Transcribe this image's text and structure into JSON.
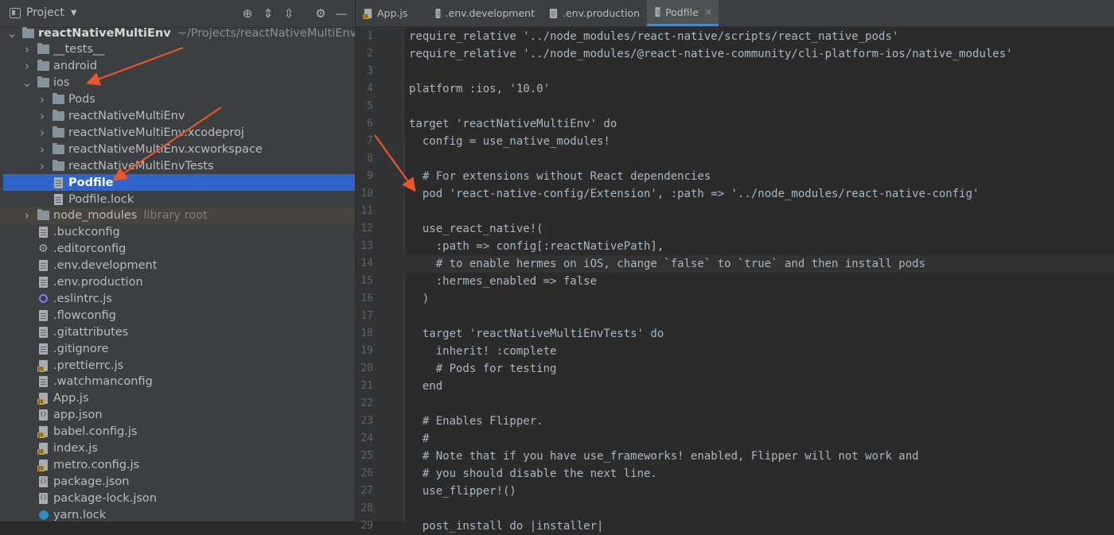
{
  "sidebar": {
    "title": "Project",
    "tree": [
      {
        "label": "reactNativeMultiEnv",
        "sub": "~/Projects/reactNativeMultiEnv",
        "type": "folder",
        "depth": 0,
        "expanded": true,
        "root": true
      },
      {
        "label": "__tests__",
        "type": "folder",
        "depth": 1,
        "expanded": false
      },
      {
        "label": "android",
        "type": "folder",
        "depth": 1,
        "expanded": false
      },
      {
        "label": "ios",
        "type": "folder",
        "depth": 1,
        "expanded": true
      },
      {
        "label": "Pods",
        "type": "folder",
        "depth": 2,
        "expanded": false
      },
      {
        "label": "reactNativeMultiEnv",
        "type": "folder",
        "depth": 2,
        "expanded": false
      },
      {
        "label": "reactNativeMultiEnv.xcodeproj",
        "type": "folder",
        "depth": 2,
        "expanded": false
      },
      {
        "label": "reactNativeMultiEnv.xcworkspace",
        "type": "folder",
        "depth": 2,
        "expanded": false
      },
      {
        "label": "reactNativeMultiEnvTests",
        "type": "folder",
        "depth": 2,
        "expanded": false
      },
      {
        "label": "Podfile",
        "type": "file",
        "depth": 2,
        "selected": true
      },
      {
        "label": "Podfile.lock",
        "type": "file",
        "depth": 2
      },
      {
        "label": "node_modules",
        "sub": "library root",
        "type": "folder",
        "depth": 1,
        "expanded": false,
        "libroot": true
      },
      {
        "label": ".buckconfig",
        "type": "file",
        "depth": 1
      },
      {
        "label": ".editorconfig",
        "type": "gear",
        "depth": 1
      },
      {
        "label": ".env.development",
        "type": "file",
        "depth": 1
      },
      {
        "label": ".env.production",
        "type": "file",
        "depth": 1
      },
      {
        "label": ".eslintrc.js",
        "type": "eslint",
        "depth": 1
      },
      {
        "label": ".flowconfig",
        "type": "file",
        "depth": 1
      },
      {
        "label": ".gitattributes",
        "type": "file",
        "depth": 1
      },
      {
        "label": ".gitignore",
        "type": "file",
        "depth": 1
      },
      {
        "label": ".prettierrc.js",
        "type": "js",
        "depth": 1
      },
      {
        "label": ".watchmanconfig",
        "type": "file",
        "depth": 1
      },
      {
        "label": "App.js",
        "type": "js",
        "depth": 1
      },
      {
        "label": "app.json",
        "type": "json",
        "depth": 1
      },
      {
        "label": "babel.config.js",
        "type": "js",
        "depth": 1
      },
      {
        "label": "index.js",
        "type": "js",
        "depth": 1
      },
      {
        "label": "metro.config.js",
        "type": "js",
        "depth": 1
      },
      {
        "label": "package.json",
        "type": "json",
        "depth": 1
      },
      {
        "label": "package-lock.json",
        "type": "json",
        "depth": 1
      },
      {
        "label": "yarn.lock",
        "type": "yarn",
        "depth": 1
      }
    ]
  },
  "tabs": [
    {
      "label": "App.js",
      "icon": "js-file-icon",
      "active": false
    },
    {
      "label": ".env.development",
      "icon": "file-icon",
      "active": false
    },
    {
      "label": ".env.production",
      "icon": "file-icon",
      "active": false
    },
    {
      "label": "Podfile",
      "icon": "file-icon",
      "active": true
    }
  ],
  "editor": {
    "current_line": 14,
    "lines": [
      "require_relative '../node_modules/react-native/scripts/react_native_pods'",
      "require_relative '../node_modules/@react-native-community/cli-platform-ios/native_modules'",
      "",
      "platform :ios, '10.0'",
      "",
      "target 'reactNativeMultiEnv' do",
      "  config = use_native_modules!",
      "",
      "  # For extensions without React dependencies",
      "  pod 'react-native-config/Extension', :path => '../node_modules/react-native-config'",
      "",
      "  use_react_native!(",
      "    :path => config[:reactNativePath],",
      "    # to enable hermes on iOS, change `false` to `true` and then install pods",
      "    :hermes_enabled => false",
      "  )",
      "",
      "  target 'reactNativeMultiEnvTests' do",
      "    inherit! :complete",
      "    # Pods for testing",
      "  end",
      "",
      "  # Enables Flipper.",
      "  #",
      "  # Note that if you have use_frameworks! enabled, Flipper will not work and",
      "  # you should disable the next line.",
      "  use_flipper!()",
      "",
      "  post_install do |installer|"
    ]
  },
  "annotation_color": "#e8562a"
}
